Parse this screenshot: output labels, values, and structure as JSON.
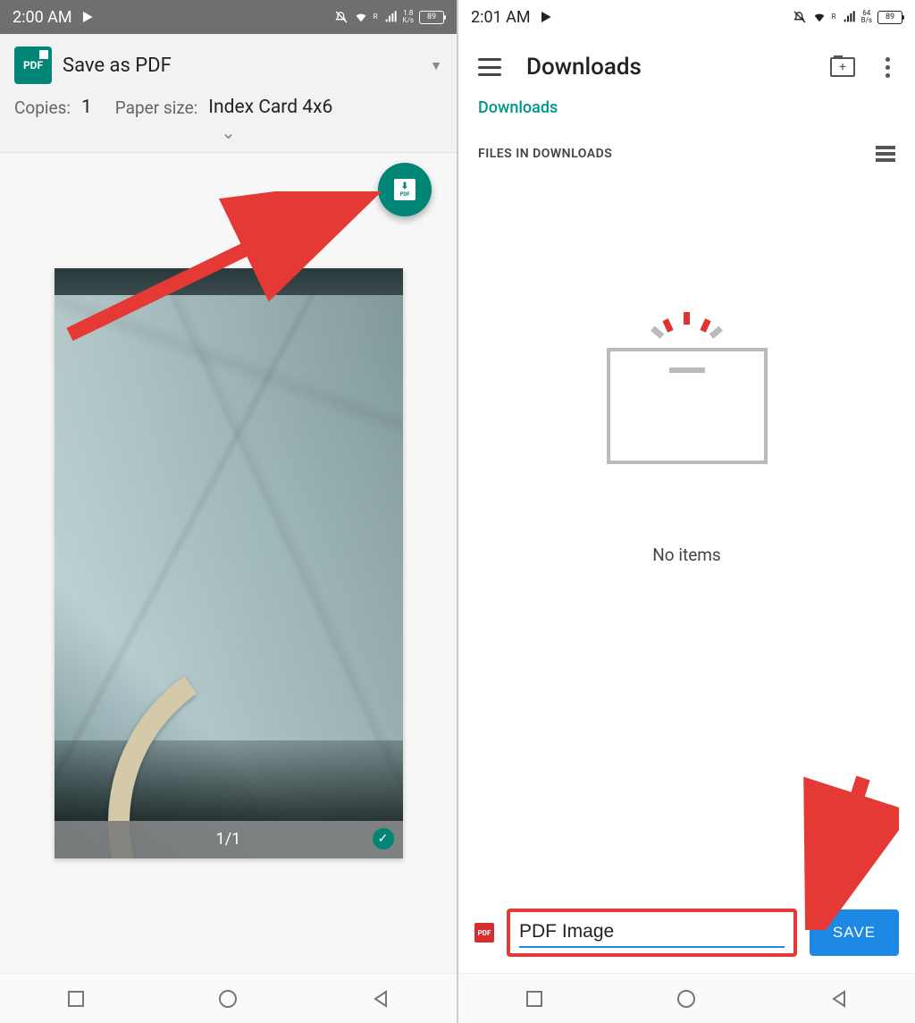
{
  "left": {
    "status": {
      "time": "2:00 AM",
      "net_rate": "1.8",
      "net_unit": "K/s",
      "battery": "89",
      "roaming": "R"
    },
    "print": {
      "target": "Save as PDF",
      "copies_label": "Copies:",
      "copies_value": "1",
      "paper_label": "Paper size:",
      "paper_value": "Index Card 4x6"
    },
    "preview": {
      "page_indicator": "1/1"
    }
  },
  "right": {
    "status": {
      "time": "2:01 AM",
      "net_rate": "64",
      "net_unit": "B/s",
      "battery": "89",
      "roaming": "R"
    },
    "header": {
      "title": "Downloads"
    },
    "breadcrumb": "Downloads",
    "section_label": "FILES IN DOWNLOADS",
    "empty_text": "No items",
    "filename": "PDF Image",
    "save_label": "SAVE",
    "pdf_badge": "PDF"
  },
  "icons": {
    "pdf": "PDF"
  }
}
